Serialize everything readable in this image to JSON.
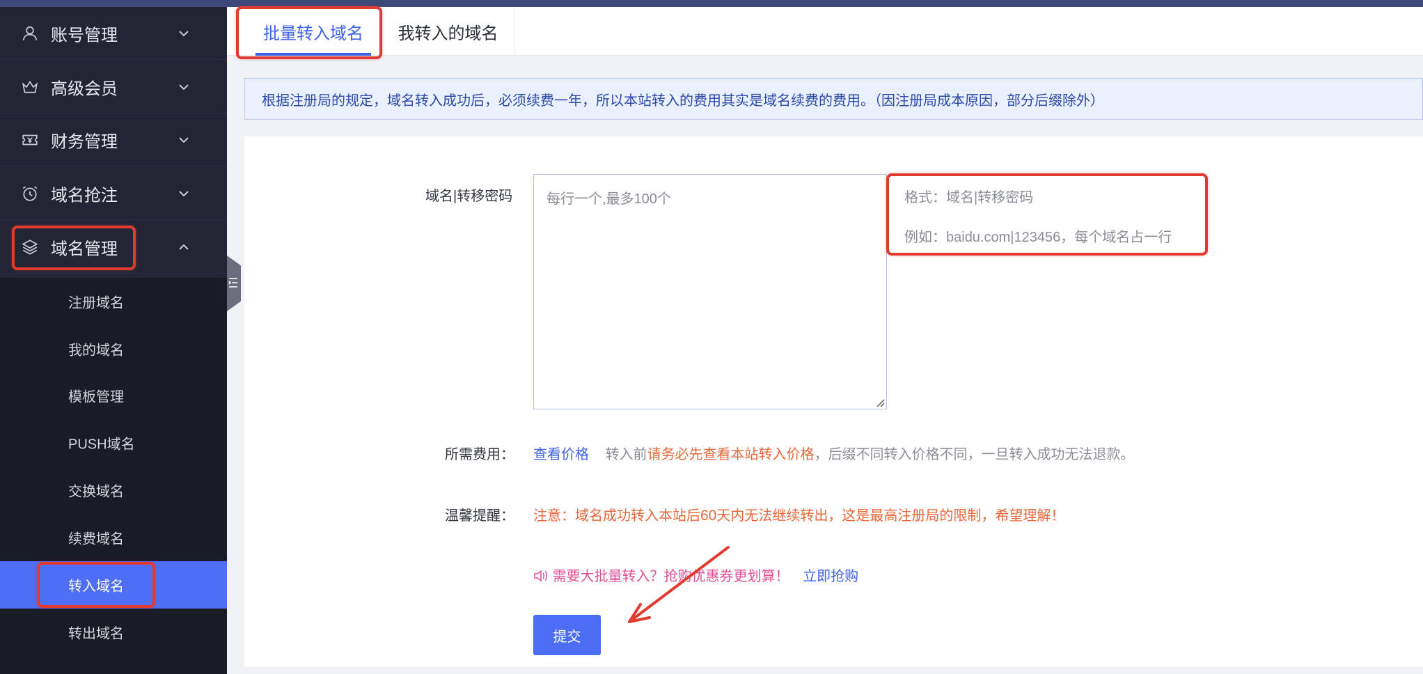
{
  "sidebar": {
    "groups": [
      {
        "label": "账号管理",
        "icon": "user-icon",
        "expanded": false
      },
      {
        "label": "高级会员",
        "icon": "crown-icon",
        "expanded": false
      },
      {
        "label": "财务管理",
        "icon": "ticket-icon",
        "expanded": false
      },
      {
        "label": "域名抢注",
        "icon": "alarm-clock-icon",
        "expanded": false
      },
      {
        "label": "域名管理",
        "icon": "layers-icon",
        "expanded": true
      }
    ],
    "sub_items": [
      {
        "label": "注册域名"
      },
      {
        "label": "我的域名"
      },
      {
        "label": "模板管理"
      },
      {
        "label": "PUSH域名"
      },
      {
        "label": "交换域名"
      },
      {
        "label": "续费域名"
      },
      {
        "label": "转入域名",
        "active": true
      },
      {
        "label": "转出域名"
      }
    ]
  },
  "tabs": [
    {
      "label": "批量转入域名",
      "active": true
    },
    {
      "label": "我转入的域名",
      "active": false
    }
  ],
  "notice": "根据注册局的规定，域名转入成功后，必须续费一年，所以本站转入的费用其实是域名续费的费用。（因注册局成本原因，部分后缀除外）",
  "form": {
    "domain_label": "域名|转移密码",
    "textarea_placeholder": "每行一个,最多100个",
    "hint_format": "格式：域名|转移密码",
    "hint_example": "例如：baidu.com|123456，每个域名占一行",
    "fee_label": "所需费用：",
    "fee_link": "查看价格",
    "fee_text_before": "转入前",
    "fee_text_highlight": "请务必先查看本站转入价格",
    "fee_text_after": "，后缀不同转入价格不同，一旦转入成功无法退款。",
    "reminder_label": "温馨提醒：",
    "reminder_text_1": "注意：域名成功转入本站后",
    "reminder_days": "60",
    "reminder_text_2": "天内无法继续转出，这是最高注册局的限制，希望理解！",
    "promo_text": "需要大批量转入？抢购优惠券更划算！",
    "promo_link": "立即抢购",
    "submit_label": "提交"
  },
  "colors": {
    "sidebar_bg": "#232535",
    "submenu_bg": "#191b27",
    "accent": "#4d6ef5",
    "link": "#3f63e8",
    "warning": "#e8673b",
    "promo": "#e14e97",
    "annotation": "#e03a31"
  }
}
